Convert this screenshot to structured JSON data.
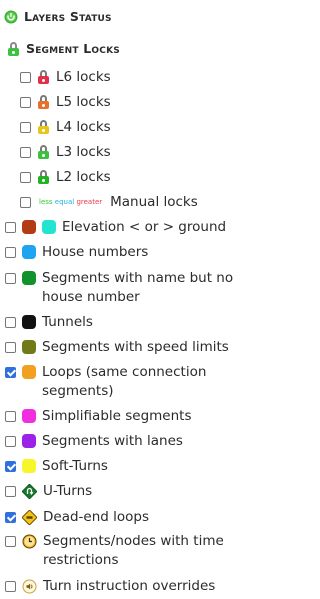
{
  "header": {
    "title": "Layers Status"
  },
  "segment_locks": {
    "title": "Segment Locks",
    "items": [
      {
        "label": "L6 locks",
        "checked": false,
        "color": "#e0304a"
      },
      {
        "label": "L5 locks",
        "checked": false,
        "color": "#e9702a"
      },
      {
        "label": "L4 locks",
        "checked": false,
        "color": "#e6c61c"
      },
      {
        "label": "L3 locks",
        "checked": false,
        "color": "#3fbf3f"
      },
      {
        "label": "L2 locks",
        "checked": false,
        "color": "#22b122"
      }
    ],
    "manual": {
      "label": "Manual locks",
      "checked": false,
      "legend": {
        "less": "less",
        "equal": "equal",
        "greater": "greater"
      },
      "legend_colors": {
        "less": "#34c834",
        "equal": "#19b4e6",
        "greater": "#e83a4e"
      }
    }
  },
  "layers": [
    {
      "label": "Elevation < or > ground",
      "checked": false,
      "icon": "elevation-swatch",
      "colors": [
        "#b23a14",
        "#22e4d0"
      ]
    },
    {
      "label": "House numbers",
      "checked": false,
      "icon": "swatch",
      "color": "#1ea4f0"
    },
    {
      "label": "Segments with name but no house number",
      "checked": false,
      "icon": "swatch",
      "color": "#12922c"
    },
    {
      "label": "Tunnels",
      "checked": false,
      "icon": "swatch",
      "color": "#111111"
    },
    {
      "label": "Segments with speed limits",
      "checked": false,
      "icon": "swatch",
      "color": "#727a18"
    },
    {
      "label": "Loops (same connection segments)",
      "checked": true,
      "icon": "swatch",
      "color": "#f2a022"
    },
    {
      "label": "Simplifiable segments",
      "checked": false,
      "icon": "swatch",
      "color": "#f02ee0"
    },
    {
      "label": "Segments with lanes",
      "checked": false,
      "icon": "swatch",
      "color": "#9b22e6"
    },
    {
      "label": "Soft-Turns",
      "checked": true,
      "icon": "swatch",
      "color": "#f6f62a"
    },
    {
      "label": "U-Turns",
      "checked": false,
      "icon": "u-turn-sign-icon"
    },
    {
      "label": "Dead-end loops",
      "checked": true,
      "icon": "dead-end-sign-icon"
    },
    {
      "label": "Segments/nodes with time restrictions",
      "checked": false,
      "icon": "clock-icon"
    },
    {
      "label": "Turn instruction overrides",
      "checked": false,
      "icon": "speaker-icon"
    }
  ]
}
